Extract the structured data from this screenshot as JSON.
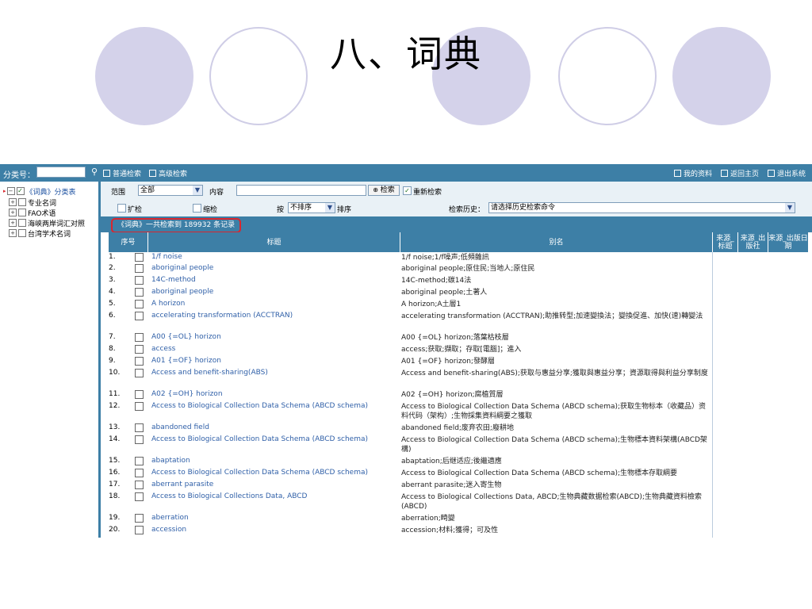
{
  "slide": {
    "title": "八、词典"
  },
  "left_panel": {
    "category_label": "分类号：",
    "category_value": "",
    "search_icon": "search-icon",
    "tree": [
      {
        "label": "《词典》分类表",
        "checked": true
      },
      {
        "label": "专业名词",
        "checked": false
      },
      {
        "label": "FAO术语",
        "checked": false
      },
      {
        "label": "海峡两岸词汇对照",
        "checked": false
      },
      {
        "label": "台湾学术名词",
        "checked": false
      }
    ]
  },
  "topbar": {
    "basic_search": "普通检索",
    "advanced_search": "高级检索",
    "my_info": "我的资料",
    "return_home": "返回主页",
    "exit": "退出系统"
  },
  "search_form": {
    "scope_label": "范围",
    "scope_value": "全部",
    "content_label": "内容",
    "content_value": "",
    "search_button": "检索",
    "new_search_label": "重新检索",
    "new_search_checked": true,
    "expand_label": "扩检",
    "narrow_label": "缩检",
    "sort_by_label": "按",
    "sort_value": "不排序",
    "sort_label": "排序",
    "history_label": "检索历史：",
    "history_value": "请选择历史检索命令"
  },
  "result_summary": "《词典》一共检索到  189932 条记录",
  "table": {
    "headers": {
      "index": "序号",
      "title": "标题",
      "alias": "别名",
      "source_title": "来源_标题",
      "source_publisher": "来源_出版社",
      "source_date": "来源_出版日期"
    },
    "rows": [
      {
        "n": "1.",
        "title": "1/f noise",
        "alias": "1/f noise;1/f噪声;低頻雜訊"
      },
      {
        "n": "2.",
        "title": "aboriginal people",
        "alias": "aboriginal people;原住民;当地人;原住民"
      },
      {
        "n": "3.",
        "title": "14C-method",
        "alias": "14C-method;碳14法"
      },
      {
        "n": "4.",
        "title": "aboriginal people",
        "alias": "aboriginal people;土著人"
      },
      {
        "n": "5.",
        "title": "A horizon",
        "alias": "A horizon;A土層1"
      },
      {
        "n": "6.",
        "title": "accelerating transformation (ACCTRAN)",
        "alias": "accelerating transformation (ACCTRAN);助推转型;加速變換法；變換促進、加快(速)轉變法"
      },
      {
        "n": "7.",
        "title": "A00 {=OL} horizon",
        "alias": "A00 {=OL} horizon;落葉枯枝層"
      },
      {
        "n": "8.",
        "title": "access",
        "alias": "access;获取;擷取；存取[電腦]；進入"
      },
      {
        "n": "9.",
        "title": "A01 {=OF} horizon",
        "alias": "A01 {=OF} horizon;發酵層"
      },
      {
        "n": "10.",
        "title": "Access and benefit-sharing(ABS)",
        "alias": "Access and benefit-sharing(ABS);获取与惠益分享;獲取與惠益分享；資源取得與利益分享制度"
      },
      {
        "n": "11.",
        "title": "A02 {=OH} horizon",
        "alias": "A02 {=OH} horizon;腐植質層"
      },
      {
        "n": "12.",
        "title": "Access to Biological Collection Data Schema (ABCD schema)",
        "alias": "Access to Biological Collection Data Schema (ABCD schema);获取生物标本（收藏品）资料代码（架构）;生物採集資料綱要之獲取"
      },
      {
        "n": "13.",
        "title": "abandoned field",
        "alias": "abandoned field;废弃农田;廢耕地"
      },
      {
        "n": "14.",
        "title": "Access to Biological Collection Data Schema (ABCD schema)",
        "alias": "Access to Biological Collection Data Schema (ABCD schema);生物標本資料架構(ABCD架構)"
      },
      {
        "n": "15.",
        "title": "abaptation",
        "alias": "abaptation;后继适应;後繼適應"
      },
      {
        "n": "16.",
        "title": "Access to Biological Collection Data Schema (ABCD schema)",
        "alias": "Access to Biological Collection Data Schema (ABCD schema);生物標本存取綱要"
      },
      {
        "n": "17.",
        "title": "aberrant parasite",
        "alias": "aberrant parasite;迷入寄生物"
      },
      {
        "n": "18.",
        "title": "Access to Biological Collections Data, ABCD",
        "alias": "Access to Biological Collections Data, ABCD;生物典藏数据检索(ABCD);生物典藏資料檢索(ABCD)"
      },
      {
        "n": "19.",
        "title": "aberration",
        "alias": "aberration;畸變"
      },
      {
        "n": "20.",
        "title": "accession",
        "alias": "accession;材料;獲得；可及性"
      }
    ]
  },
  "colors": {
    "bar": "#3d7fa6",
    "panel": "#e9f1f6",
    "link": "#3060a8",
    "highlight_border": "#d9262d",
    "circle_fill": "#d4d2ea"
  }
}
